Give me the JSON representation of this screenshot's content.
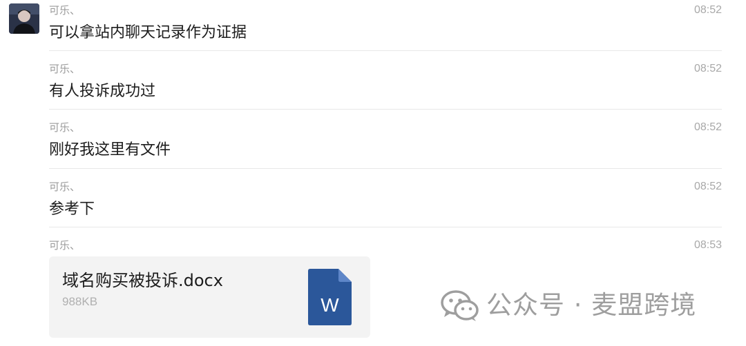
{
  "messages": [
    {
      "sender": "可乐、",
      "time": "08:52",
      "text": "可以拿站内聊天记录作为证据"
    },
    {
      "sender": "可乐、",
      "time": "08:52",
      "text": "有人投诉成功过"
    },
    {
      "sender": "可乐、",
      "time": "08:52",
      "text": "刚好我这里有文件"
    },
    {
      "sender": "可乐、",
      "time": "08:52",
      "text": "参考下"
    },
    {
      "sender": "可乐、",
      "time": "08:53",
      "file": {
        "name": "域名购买被投诉.docx",
        "size": "988KB",
        "icon": "word-doc-icon",
        "icon_letter": "W",
        "icon_color": "#2b579a"
      }
    }
  ],
  "watermark": {
    "text": "公众号 · 麦盟跨境",
    "icon": "wechat-icon"
  }
}
